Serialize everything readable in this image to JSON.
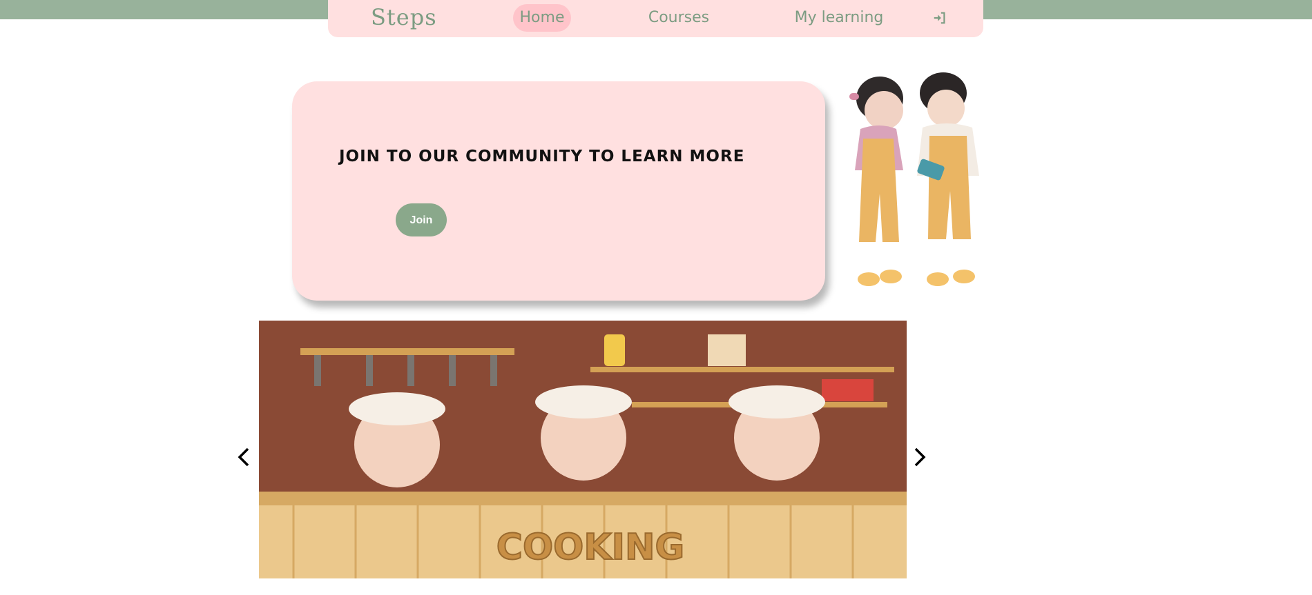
{
  "nav": {
    "brand": "Steps",
    "links": [
      {
        "label": "Home",
        "active": true
      },
      {
        "label": "Courses"
      },
      {
        "label": "My learning"
      }
    ],
    "login_icon": "login-icon"
  },
  "hero": {
    "headline": "JOIN TO OUR COMMUNITY TO LEARN MORE",
    "join_label": "Join",
    "illustration": "kids-with-phone-illustration"
  },
  "carousel": {
    "image_label": "COOKING",
    "prev_icon": "chevron-left-icon",
    "next_icon": "chevron-right-icon"
  },
  "colors": {
    "accent_green": "#98b29b",
    "brand_text": "#7c9c82",
    "pink_bg": "#ffe0e0",
    "active_pill": "#ffc4ca",
    "button": "#8aa88b"
  }
}
